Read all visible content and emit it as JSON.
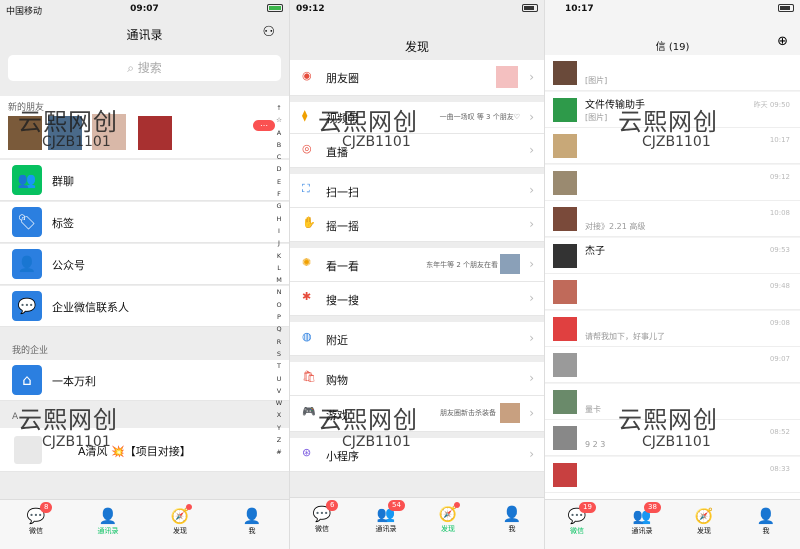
{
  "panel1": {
    "status": {
      "carrier": "中国移动",
      "time": "09:07"
    },
    "title": "通讯录",
    "search_placeholder": "搜索",
    "new_friends_label": "新的朋友",
    "items": [
      "群聊",
      "标签",
      "公众号",
      "企业微信联系人"
    ],
    "my_enterprise": "我的企业",
    "enterprise": "一本万利",
    "section_a": "A",
    "contact_a": "A清风 💥【项目对接】",
    "index": [
      "↑",
      "☆",
      "A",
      "B",
      "C",
      "D",
      "E",
      "F",
      "G",
      "H",
      "I",
      "J",
      "K",
      "L",
      "M",
      "N",
      "O",
      "P",
      "Q",
      "R",
      "S",
      "T",
      "U",
      "V",
      "W",
      "X",
      "Y",
      "Z",
      "#"
    ],
    "tabs": [
      "微信",
      "通讯录",
      "发现",
      "我"
    ],
    "badge_wechat": "8"
  },
  "panel2": {
    "status": {
      "time": "09:12"
    },
    "title": "发现",
    "items": [
      "朋友圈",
      "视频号",
      "直播",
      "扫一扫",
      "摇一摇",
      "看一看",
      "搜一搜",
      "附近",
      "购物",
      "游戏",
      "小程序"
    ],
    "video_preview": "一曲一场叹 等 3 个朋友♡",
    "kankan_preview": "东年牛等 2 个朋友在看",
    "game_preview": "朋友圈新击杀装备",
    "tabs": [
      "微信",
      "通讯录",
      "发现",
      "我"
    ],
    "badge_wechat": "6",
    "badge_contacts": "54"
  },
  "panel3": {
    "status": {
      "time": "10:17"
    },
    "title": "信 (19)",
    "chats": [
      {
        "name": "",
        "preview": "[图片]",
        "time": ""
      },
      {
        "name": "文件传输助手",
        "preview": "[图片]",
        "time": "昨天 09:50"
      },
      {
        "name": "",
        "preview": "",
        "time": "10:17"
      },
      {
        "name": "",
        "preview": "",
        "time": "09:12"
      },
      {
        "name": "",
        "preview": "对接》2.21 高级",
        "time": "10:08"
      },
      {
        "name": "杰子",
        "preview": "",
        "time": "09:53"
      },
      {
        "name": "",
        "preview": "",
        "time": "09:48"
      },
      {
        "name": "",
        "preview": "请帮我加下，好事儿了",
        "time": "09:08"
      },
      {
        "name": "",
        "preview": "",
        "time": "09:07"
      },
      {
        "name": "",
        "preview": "量卡",
        "time": ""
      },
      {
        "name": "",
        "preview": "9 2 3",
        "time": "08:52"
      },
      {
        "name": "",
        "preview": "",
        "time": "08:33"
      },
      {
        "name": "",
        "preview": "",
        "time": ""
      }
    ],
    "tabs": [
      "微信",
      "通讯录",
      "发现",
      "我"
    ],
    "badge_wechat": "19",
    "badge_contacts": "38"
  },
  "watermark": {
    "line1": "云熙网创",
    "line2": "CJZB1101"
  }
}
